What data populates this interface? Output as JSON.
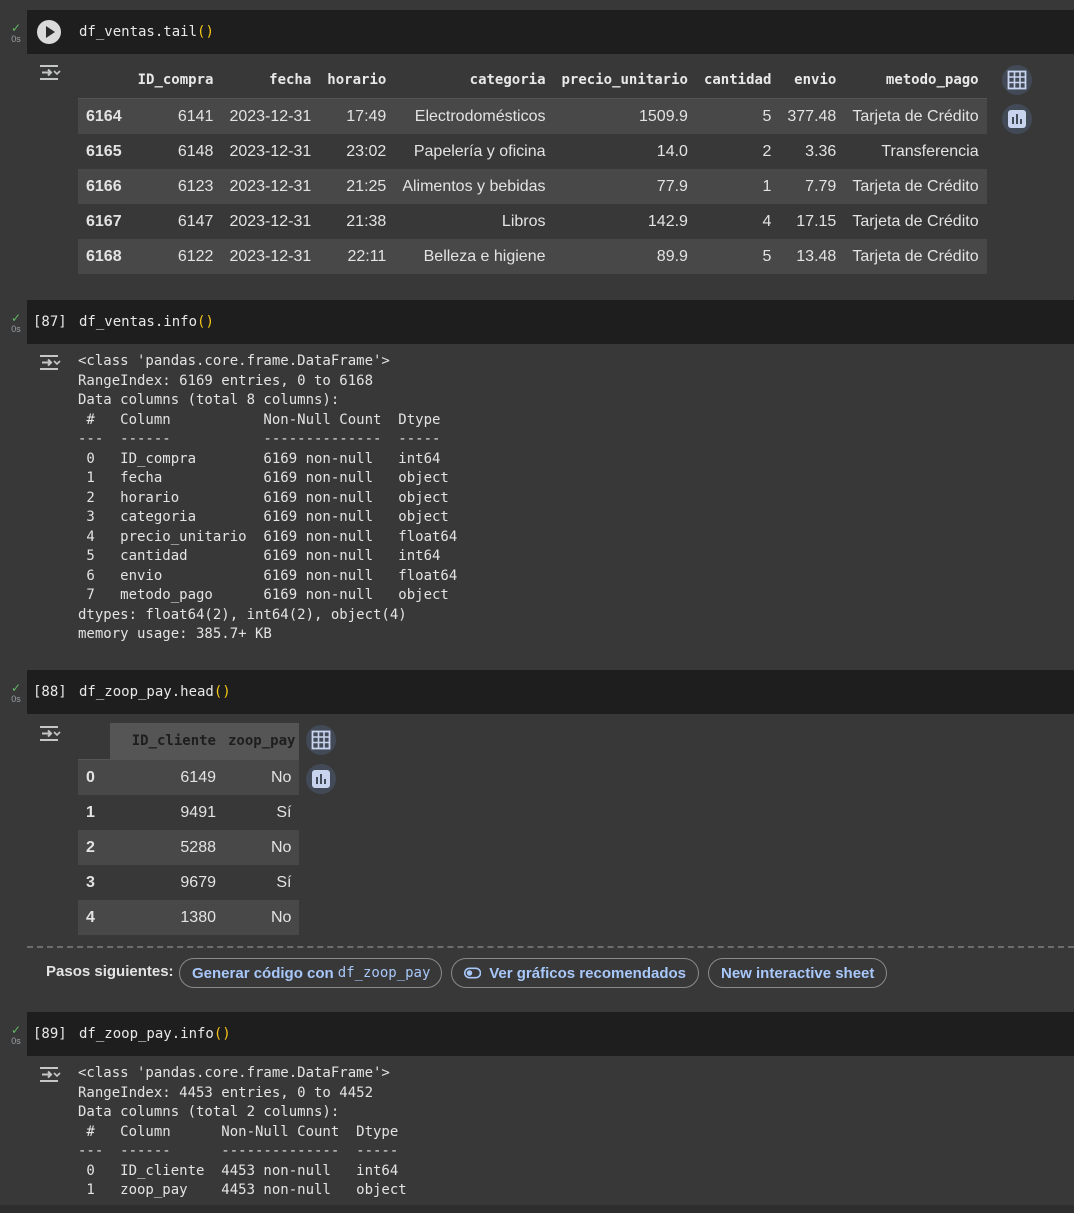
{
  "cells": [
    {
      "status_time": "0s",
      "code": "df_ventas.tail",
      "code_paren": "()",
      "table": {
        "columns": [
          "ID_compra",
          "fecha",
          "horario",
          "categoria",
          "precio_unitario",
          "cantidad",
          "envio",
          "metodo_pago"
        ],
        "rows": [
          {
            "index": "6164",
            "values": [
              "6141",
              "2023-12-31",
              "17:49",
              "Electrodomésticos",
              "1509.9",
              "5",
              "377.48",
              "Tarjeta de Crédito"
            ]
          },
          {
            "index": "6165",
            "values": [
              "6148",
              "2023-12-31",
              "23:02",
              "Papelería y oficina",
              "14.0",
              "2",
              "3.36",
              "Transferencia"
            ]
          },
          {
            "index": "6166",
            "values": [
              "6123",
              "2023-12-31",
              "21:25",
              "Alimentos y bebidas",
              "77.9",
              "1",
              "7.79",
              "Tarjeta de Crédito"
            ]
          },
          {
            "index": "6167",
            "values": [
              "6147",
              "2023-12-31",
              "21:38",
              "Libros",
              "142.9",
              "4",
              "17.15",
              "Tarjeta de Crédito"
            ]
          },
          {
            "index": "6168",
            "values": [
              "6122",
              "2023-12-31",
              "22:11",
              "Belleza e higiene",
              "89.9",
              "5",
              "13.48",
              "Tarjeta de Crédito"
            ]
          }
        ]
      }
    },
    {
      "status_time": "0s",
      "exec_count": "[87]",
      "code": "df_ventas.info",
      "code_paren": "()",
      "output": "<class 'pandas.core.frame.DataFrame'>\nRangeIndex: 6169 entries, 0 to 6168\nData columns (total 8 columns):\n #   Column           Non-Null Count  Dtype  \n---  ------           --------------  -----  \n 0   ID_compra        6169 non-null   int64  \n 1   fecha            6169 non-null   object \n 2   horario          6169 non-null   object \n 3   categoria        6169 non-null   object \n 4   precio_unitario  6169 non-null   float64\n 5   cantidad         6169 non-null   int64  \n 6   envio            6169 non-null   float64\n 7   metodo_pago      6169 non-null   object \ndtypes: float64(2), int64(2), object(4)\nmemory usage: 385.7+ KB"
    },
    {
      "status_time": "0s",
      "exec_count": "[88]",
      "code": "df_zoop_pay.head",
      "code_paren": "()",
      "table": {
        "columns": [
          "ID_cliente",
          "zoop_pay"
        ],
        "rows": [
          {
            "index": "0",
            "values": [
              "6149",
              "No"
            ]
          },
          {
            "index": "1",
            "values": [
              "9491",
              "Sí"
            ]
          },
          {
            "index": "2",
            "values": [
              "5288",
              "No"
            ]
          },
          {
            "index": "3",
            "values": [
              "9679",
              "Sí"
            ]
          },
          {
            "index": "4",
            "values": [
              "1380",
              "No"
            ]
          }
        ]
      },
      "next_steps": {
        "label": "Pasos siguientes:",
        "generate_code_label": "Generar código con",
        "generate_code_var": "df_zoop_pay",
        "recommended_charts_label": "Ver gráficos recomendados",
        "interactive_sheet_label": "New interactive sheet"
      }
    },
    {
      "status_time": "0s",
      "exec_count": "[89]",
      "code": "df_zoop_pay.info",
      "code_paren": "()",
      "output": "<class 'pandas.core.frame.DataFrame'>\nRangeIndex: 4453 entries, 0 to 4452\nData columns (total 2 columns):\n #   Column      Non-Null Count  Dtype \n---  ------      --------------  ----- \n 0   ID_cliente  4453 non-null   int64 \n 1   zoop_pay    4453 non-null   object"
    }
  ],
  "colors": {
    "background": "#383838",
    "code_bar": "#1e1e1e",
    "row_stripe": "#484848",
    "accent_link": "#a8c7fa",
    "status_ok": "#5fb760",
    "paren": "#f5c518"
  },
  "icons": {
    "run": "play-circle-icon",
    "output_toggle": "output-toggle-icon",
    "table_view": "table-grid-icon",
    "chart": "bar-chart-icon",
    "toggle_chip": "toggle-switch-icon"
  }
}
